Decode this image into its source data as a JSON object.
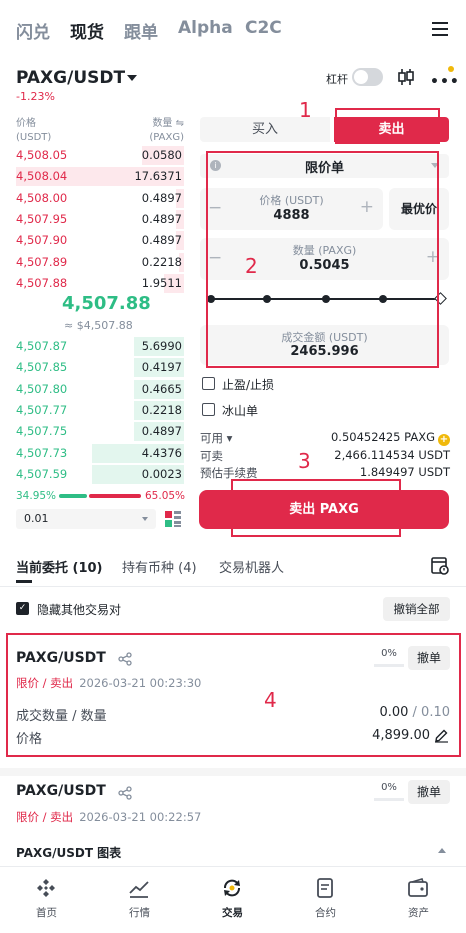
{
  "top_tabs": [
    "闪兑",
    "现货",
    "跟单",
    "Alpha",
    "C2C"
  ],
  "pair": {
    "symbol": "PAXG/USDT",
    "change": "-1.23%",
    "leverage_label": "杠杆"
  },
  "orderbook": {
    "price_header": "价格",
    "price_unit": "(USDT)",
    "qty_header": "数量 ⇋",
    "qty_unit": "(PAXG)",
    "asks": [
      {
        "price": "4,508.05",
        "qty": "0.0580",
        "depth": 0.25
      },
      {
        "price": "4,508.04",
        "qty": "17.6371",
        "depth": 1.0
      },
      {
        "price": "4,508.00",
        "qty": "0.4897",
        "depth": 0.05
      },
      {
        "price": "4,507.95",
        "qty": "0.4897",
        "depth": 0.05
      },
      {
        "price": "4,507.90",
        "qty": "0.4897",
        "depth": 0.05
      },
      {
        "price": "4,507.89",
        "qty": "0.2218",
        "depth": 0.03
      },
      {
        "price": "4,507.88",
        "qty": "1.9511",
        "depth": 0.12
      }
    ],
    "mid_price": "4,507.88",
    "mid_sub": "≈ $4,507.88",
    "bids": [
      {
        "price": "4,507.87",
        "qty": "5.6990",
        "depth": 0.3
      },
      {
        "price": "4,507.85",
        "qty": "0.4197",
        "depth": 0.3
      },
      {
        "price": "4,507.80",
        "qty": "0.4665",
        "depth": 0.3
      },
      {
        "price": "4,507.77",
        "qty": "0.2218",
        "depth": 0.3
      },
      {
        "price": "4,507.75",
        "qty": "0.4897",
        "depth": 0.3
      },
      {
        "price": "4,507.73",
        "qty": "4.4376",
        "depth": 0.55
      },
      {
        "price": "4,507.59",
        "qty": "0.0023",
        "depth": 0.55
      }
    ],
    "buy_ratio": "34.95%",
    "sell_ratio": "65.05%",
    "depth_value": "0.01"
  },
  "form": {
    "buy_tab": "买入",
    "sell_tab": "卖出",
    "order_type": "限价单",
    "price_caption": "价格 (USDT)",
    "price_value": "4888",
    "best_price": "最优价",
    "qty_caption": "数量 (PAXG)",
    "qty_value": "0.5045",
    "total_caption": "成交金额 (USDT)",
    "total_value": "2465.996",
    "tp_sl": "止盈/止损",
    "iceberg": "冰山单",
    "available_label": "可用",
    "available_value": "0.50452425 PAXG",
    "sellable_label": "可卖",
    "sellable_value": "2,466.114534 USDT",
    "fee_label": "预估手续费",
    "fee_value": "1.849497 USDT",
    "submit": "卖出 PAXG"
  },
  "annotations": [
    "1",
    "2",
    "3",
    "4"
  ],
  "orders": {
    "tabs": [
      "当前委托 (10)",
      "持有币种 (4)",
      "交易机器人"
    ],
    "hide_others": "隐藏其他交易对",
    "cancel_all": "撤销全部",
    "items": [
      {
        "pair": "PAXG/USDT",
        "side": "限价 / 卖出",
        "time": "2026-03-21 00:23:30",
        "percent": "0%",
        "cancel": "撤单",
        "filled_label": "成交数量 / 数量",
        "filled_done": "0.00",
        "filled_total": " / 0.10",
        "price_label": "价格",
        "price_value": "4,899.00"
      },
      {
        "pair": "PAXG/USDT",
        "side": "限价 / 卖出",
        "time": "2026-03-21 00:22:57",
        "percent": "0%",
        "cancel": "撤单"
      }
    ],
    "chart_label": "PAXG/USDT 图表"
  },
  "bottom_nav": [
    "首页",
    "行情",
    "交易",
    "合约",
    "资产"
  ],
  "colors": {
    "sell": "#e0294a",
    "buy": "#2ebd85",
    "accent": "#f0b90b"
  }
}
